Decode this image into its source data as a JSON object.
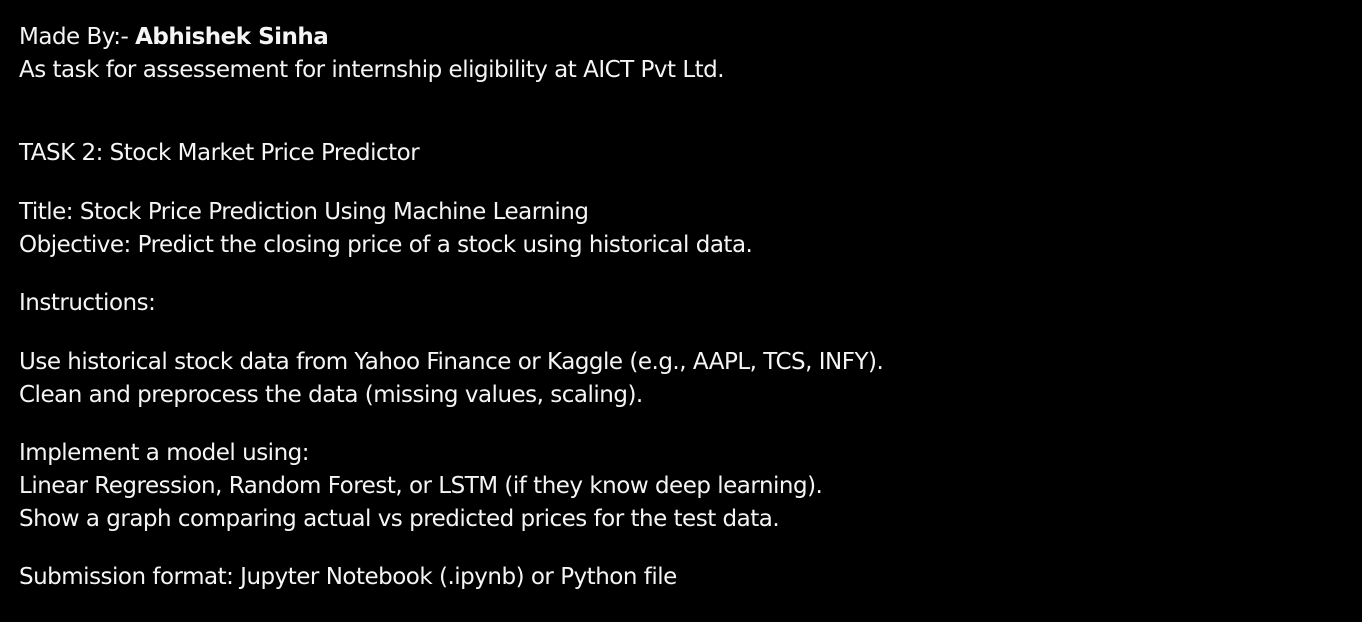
{
  "header": {
    "made_by_prefix": "Made By:- ",
    "author_name": "Abhishek Sinha",
    "purpose": "As task for assessement for internship eligibility at AICT Pvt Ltd."
  },
  "task": {
    "heading": "TASK 2: Stock Market Price Predictor",
    "title": "Title: Stock Price Prediction Using Machine Learning",
    "objective": "Objective: Predict the closing price of a stock using historical data.",
    "instructions_heading": "Instructions:",
    "instructions": [
      "Use historical stock data from Yahoo Finance or Kaggle (e.g., AAPL, TCS, INFY).",
      "Clean and preprocess the data (missing values, scaling)."
    ],
    "model_heading": "Implement a model using:",
    "model_lines": [
      "Linear Regression, Random Forest, or LSTM (if they know deep learning).",
      "Show a graph comparing actual vs predicted prices for the test data."
    ],
    "submission": "Submission format: Jupyter Notebook (.ipynb) or Python file"
  }
}
